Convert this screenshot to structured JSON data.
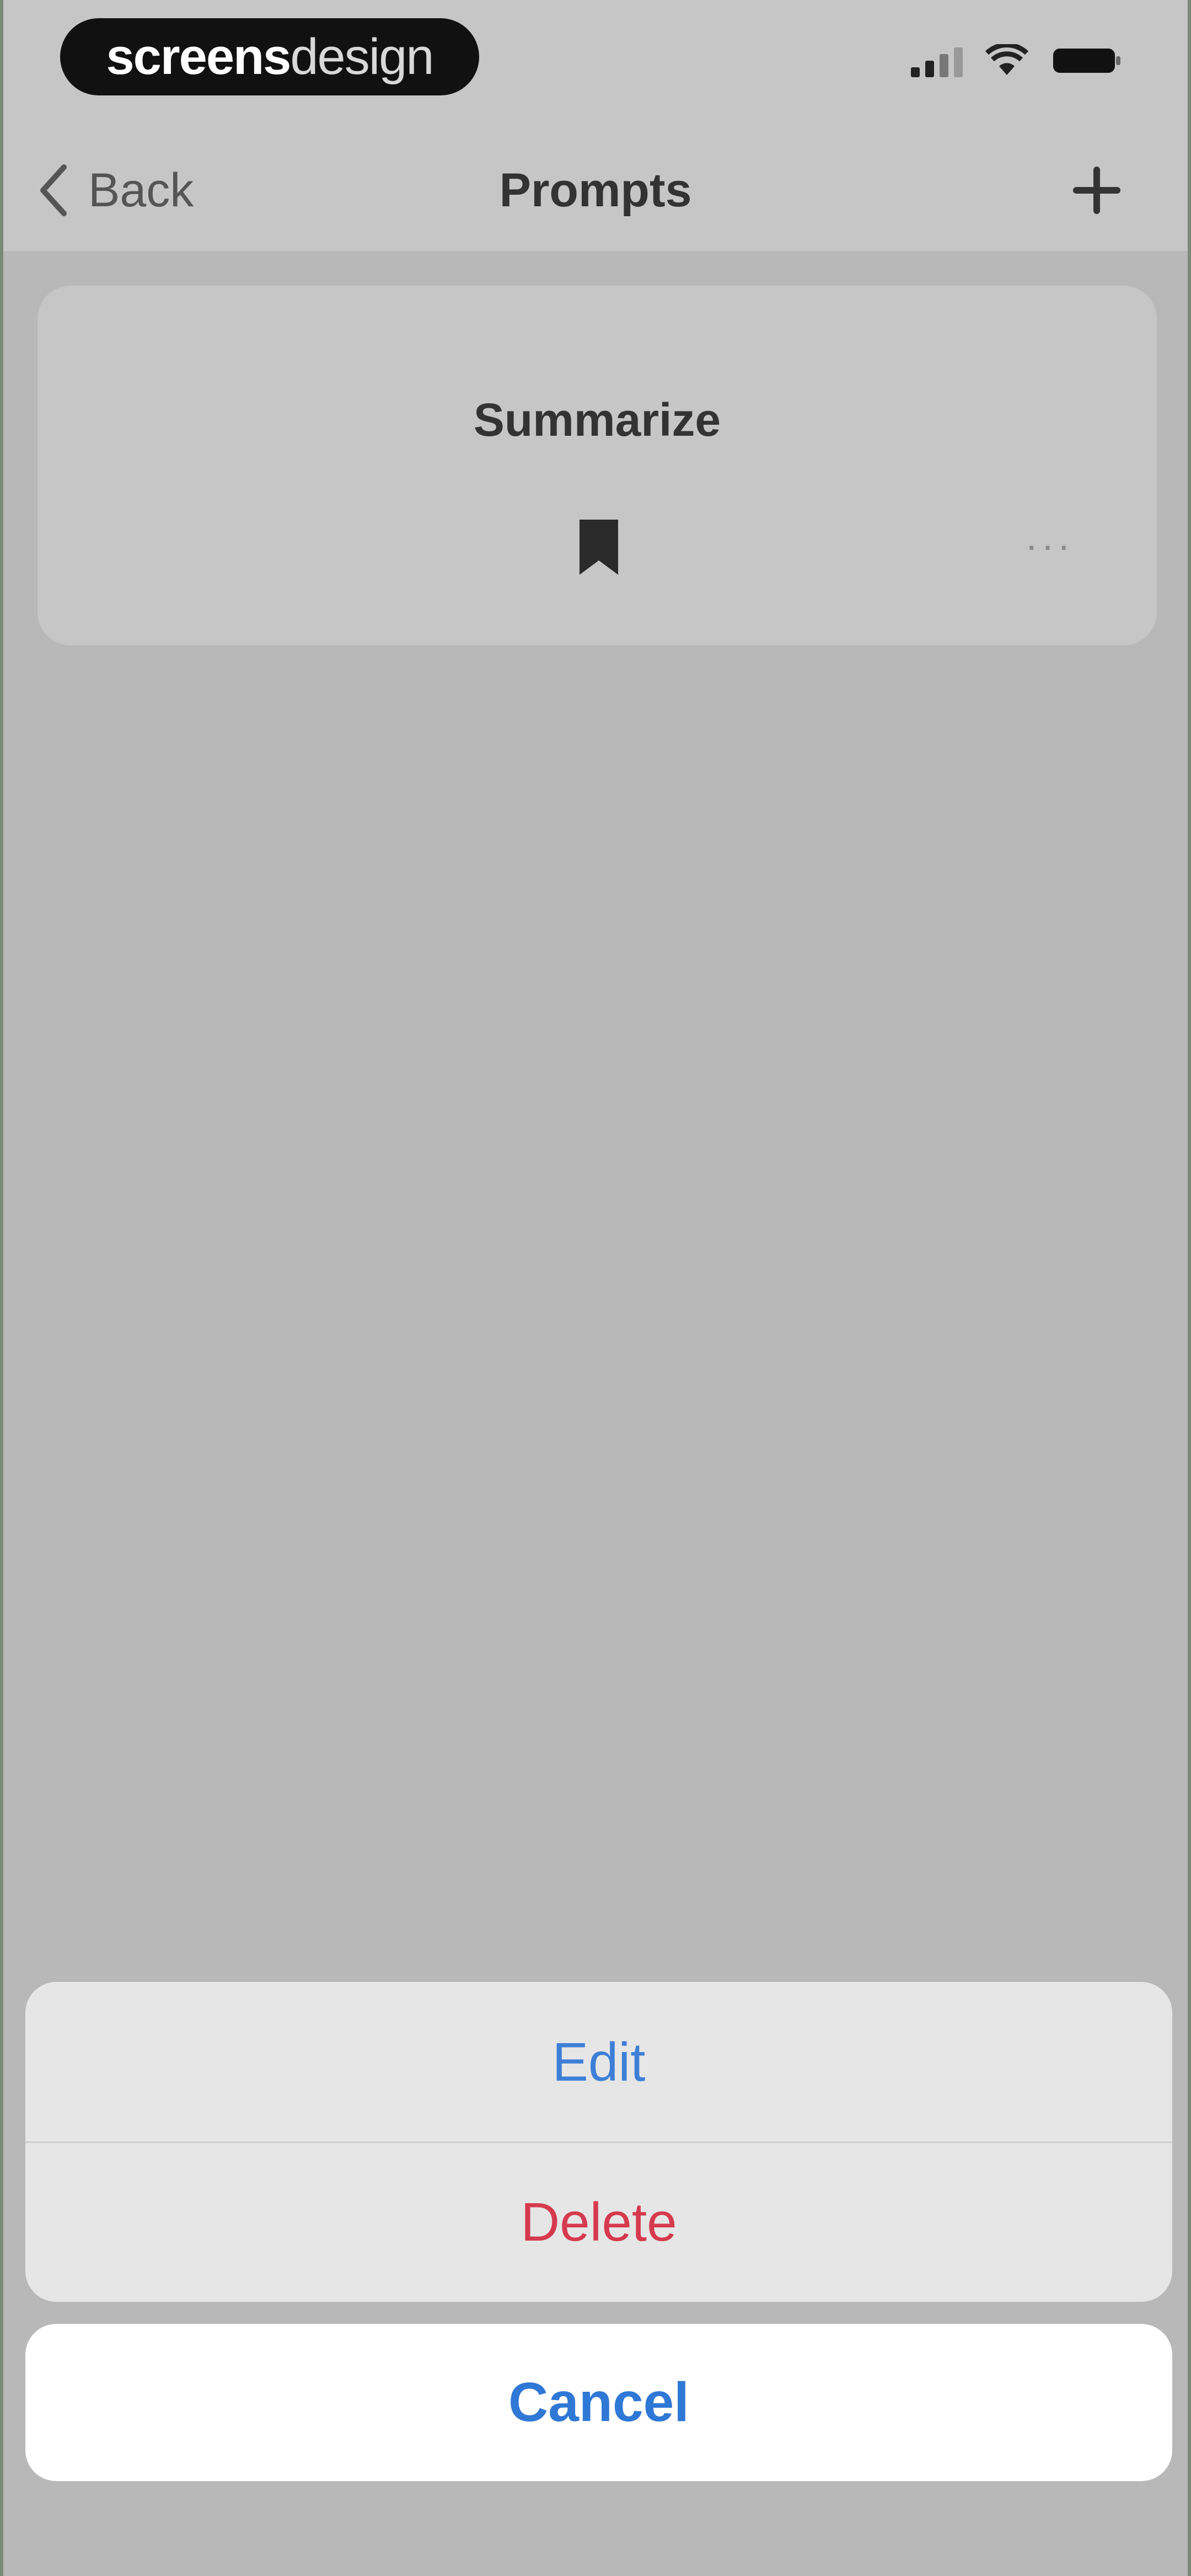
{
  "brand": {
    "bold": "screens",
    "light": "design"
  },
  "nav": {
    "back_label": "Back",
    "title": "Prompts",
    "add_icon": "plus-icon"
  },
  "prompt_card": {
    "title": "Summarize",
    "bookmark_icon": "bookmark-icon",
    "more_icon": "ellipsis-icon"
  },
  "action_sheet": {
    "edit_label": "Edit",
    "delete_label": "Delete",
    "cancel_label": "Cancel"
  },
  "colors": {
    "edit": "#3d7fd6",
    "delete": "#d63a4e",
    "cancel": "#2f78d6",
    "overlay": "#b8b8b8"
  }
}
